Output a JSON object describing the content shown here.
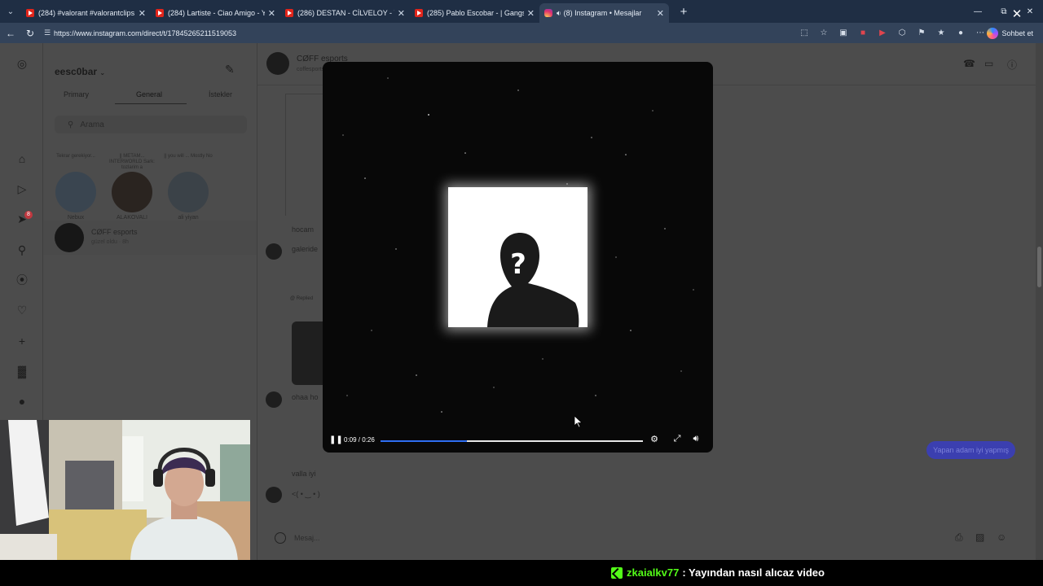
{
  "browser": {
    "tabs": [
      {
        "title": "(284) #valorant #valorantclips #va",
        "icon": "youtube-icon"
      },
      {
        "title": "(284) Lartiste - Ciao Amigo - YouTu",
        "icon": "youtube-icon"
      },
      {
        "title": "(286) DESTAN - CİLVELOY - YouTu",
        "icon": "youtube-icon"
      },
      {
        "title": "(285) Pablo Escobar - | Gangsta's P",
        "icon": "youtube-icon"
      },
      {
        "title": "(8) Instagram • Mesajlar",
        "icon": "instagram-icon",
        "active": true
      }
    ],
    "url": "https://www.instagram.com/direct/t/17845265211519053",
    "copilot_label": "Sohbet et"
  },
  "inbox": {
    "username": "eesc0bar",
    "tabs": [
      "Primary",
      "General",
      "İstekler"
    ],
    "active_tab": "General",
    "search_placeholder": "Arama",
    "notes": [
      {
        "bubble": "Tekrar gerekiyor...",
        "name": "Nebux"
      },
      {
        "bubble": "|| METAM... INTERWORLD Sark: tozlarim a",
        "name": "ALAKOVALI"
      },
      {
        "bubble": "|| you will ... Mostly No",
        "name": "ali yiyan"
      }
    ],
    "thread": {
      "name": "CØFF esports",
      "preview": "güzel oldu · 8h"
    },
    "badge_count": "8"
  },
  "chat": {
    "name": "CØFF esports",
    "handle": "coffesports16",
    "messages": [
      {
        "text": "hocam"
      },
      {
        "text": "galeride"
      },
      {
        "text": "ohaa ho"
      },
      {
        "text": "valla iyi"
      },
      {
        "text": "<( • ‿ • )"
      }
    ],
    "reply_label": "@ Replied",
    "outgoing": "Yapan adam iyi yapmış",
    "composer_placeholder": "Mesaj..."
  },
  "video": {
    "time": "0:09 / 0:26",
    "progress": 0.33
  },
  "stream": {
    "chat_user": "zkaialkv77",
    "chat_text": ": Yayından nasıl alıcaz video"
  }
}
